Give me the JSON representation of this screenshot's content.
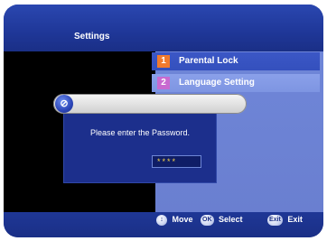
{
  "header": {
    "title": "Settings"
  },
  "menu": {
    "items": [
      {
        "number": "1",
        "label": "Parental Lock"
      },
      {
        "number": "2",
        "label": "Language Setting"
      }
    ]
  },
  "dialog": {
    "badge_icon": "lock-badge-icon",
    "message": "Please enter the Password.",
    "password_mask": "****"
  },
  "footer": {
    "hints": [
      {
        "key": "↕",
        "label": "Move"
      },
      {
        "key": "OK",
        "label": "Select"
      },
      {
        "key": "Exit",
        "label": "Exit"
      }
    ]
  },
  "colors": {
    "background_blue": "#1b2f86",
    "menu_panel": "#6f86d8",
    "item1_badge": "#f07a2e",
    "item2_badge": "#c86ad0"
  }
}
